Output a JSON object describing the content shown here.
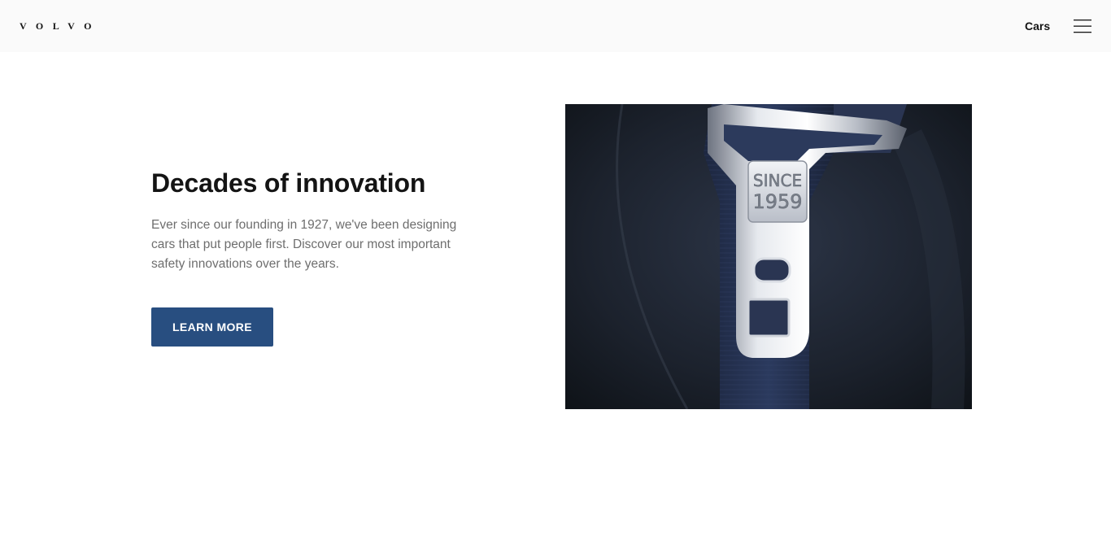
{
  "header": {
    "logo_text": "VOLVO",
    "nav_cars_label": "Cars",
    "menu_icon": "hamburger-menu-icon"
  },
  "hero": {
    "title": "Decades of innovation",
    "description": "Ever since our founding in 1927, we've been designing cars that put people first. Discover our most important safety innovations over the years.",
    "cta_label": "LEARN MORE",
    "image": {
      "engraving_line1": "SINCE",
      "engraving_line2": "1959"
    }
  },
  "colors": {
    "header_bg": "#fafafa",
    "cta_bg": "#284e80",
    "title_text": "#141414",
    "body_text": "#6e6e6e"
  }
}
